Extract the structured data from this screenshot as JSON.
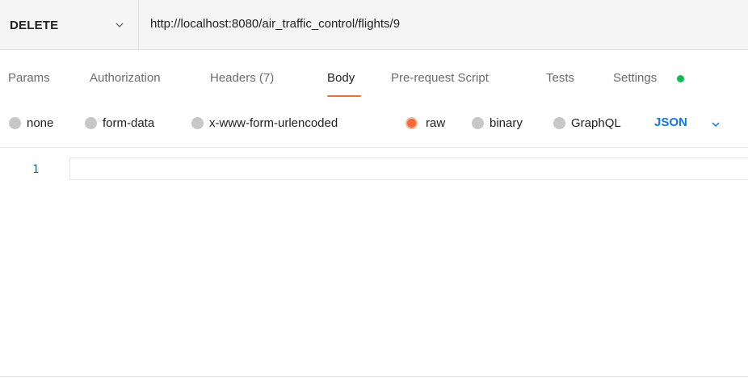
{
  "request": {
    "method": "DELETE",
    "url": "http://localhost:8080/air_traffic_control/flights/9"
  },
  "tabs": [
    {
      "label": "Params",
      "active": false
    },
    {
      "label": "Authorization",
      "active": false
    },
    {
      "label": "Headers (7)",
      "active": false
    },
    {
      "label": "Body",
      "active": true
    },
    {
      "label": "Pre-request Script",
      "active": false
    },
    {
      "label": "Tests",
      "active": false
    },
    {
      "label": "Settings",
      "active": false,
      "indicator": "green-dot"
    }
  ],
  "body_types": [
    {
      "label": "none",
      "selected": false
    },
    {
      "label": "form-data",
      "selected": false
    },
    {
      "label": "x-www-form-urlencoded",
      "selected": false
    },
    {
      "label": "raw",
      "selected": true
    },
    {
      "label": "binary",
      "selected": false
    },
    {
      "label": "GraphQL",
      "selected": false
    }
  ],
  "language": {
    "selected": "JSON"
  },
  "editor": {
    "line_numbers": [
      "1"
    ]
  },
  "colors": {
    "accent": "#f26b3a",
    "link_blue": "#097bed",
    "status_green": "#0cbb52"
  },
  "icons": {
    "method_dropdown": "chevron-down-icon",
    "language_dropdown": "chevron-down-icon",
    "settings_indicator": "status-dot-icon"
  }
}
